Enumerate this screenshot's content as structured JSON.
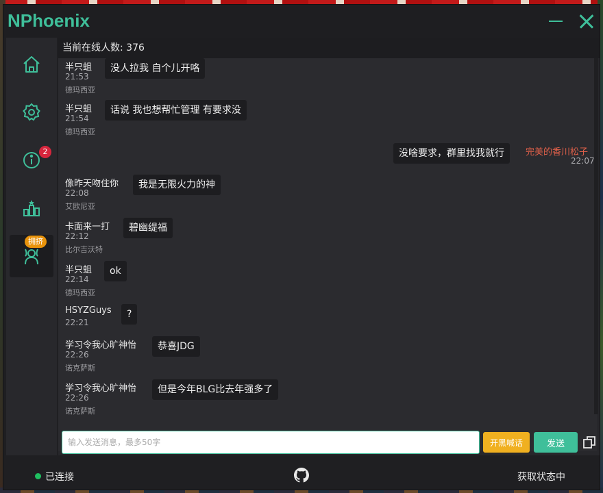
{
  "app": {
    "title": "NPhoenix"
  },
  "sidebar": {
    "items": [
      {
        "icon": "home-icon"
      },
      {
        "icon": "gear-icon"
      },
      {
        "icon": "info-icon",
        "badge": "2"
      },
      {
        "icon": "ranking-icon"
      },
      {
        "icon": "people-icon",
        "badge": "拥挤"
      }
    ]
  },
  "header": {
    "online": "当前在线人数: 376"
  },
  "messages": [
    {
      "name": "半只蛆",
      "time": "21:53",
      "area": "德玛西亚",
      "text": "没人拉我 自个儿开咯"
    },
    {
      "name": "半只蛆",
      "time": "21:54",
      "area": "德玛西亚",
      "text": "话说 我也想帮忙管理  有要求没"
    },
    {
      "self": true,
      "name": "完美的香川松子",
      "time": "22:07",
      "text": "没啥要求，群里找我就行"
    },
    {
      "name": "像昨天吻住你",
      "time": "22:08",
      "area": "艾欧尼亚",
      "text": "我是无限火力的神"
    },
    {
      "name": "卡面来一打",
      "time": "22:12",
      "area": "比尔吉沃特",
      "text": "碧幽缇福"
    },
    {
      "name": "半只蛆",
      "time": "22:14",
      "area": "德玛西亚",
      "text": "ok"
    },
    {
      "name": "HSYZGuys",
      "time": "22:21",
      "area": "",
      "text": "?"
    },
    {
      "name": "学习令我心旷神怡",
      "time": "22:26",
      "area": "诺克萨斯",
      "text": "恭喜JDG"
    },
    {
      "name": "学习令我心旷神怡",
      "time": "22:26",
      "area": "诺克萨斯",
      "text": "但是今年BLG比去年强多了"
    }
  ],
  "composer": {
    "placeholder": "输入发送消息，最多50字",
    "black_label": "开黑喊话",
    "send_label": "发送"
  },
  "status": {
    "connected": "已连接",
    "right": "获取状态中"
  },
  "colors": {
    "accent": "#3fbf9a",
    "warning": "#f0b020",
    "self_name": "#e0604a",
    "badge": "#d7263d"
  }
}
